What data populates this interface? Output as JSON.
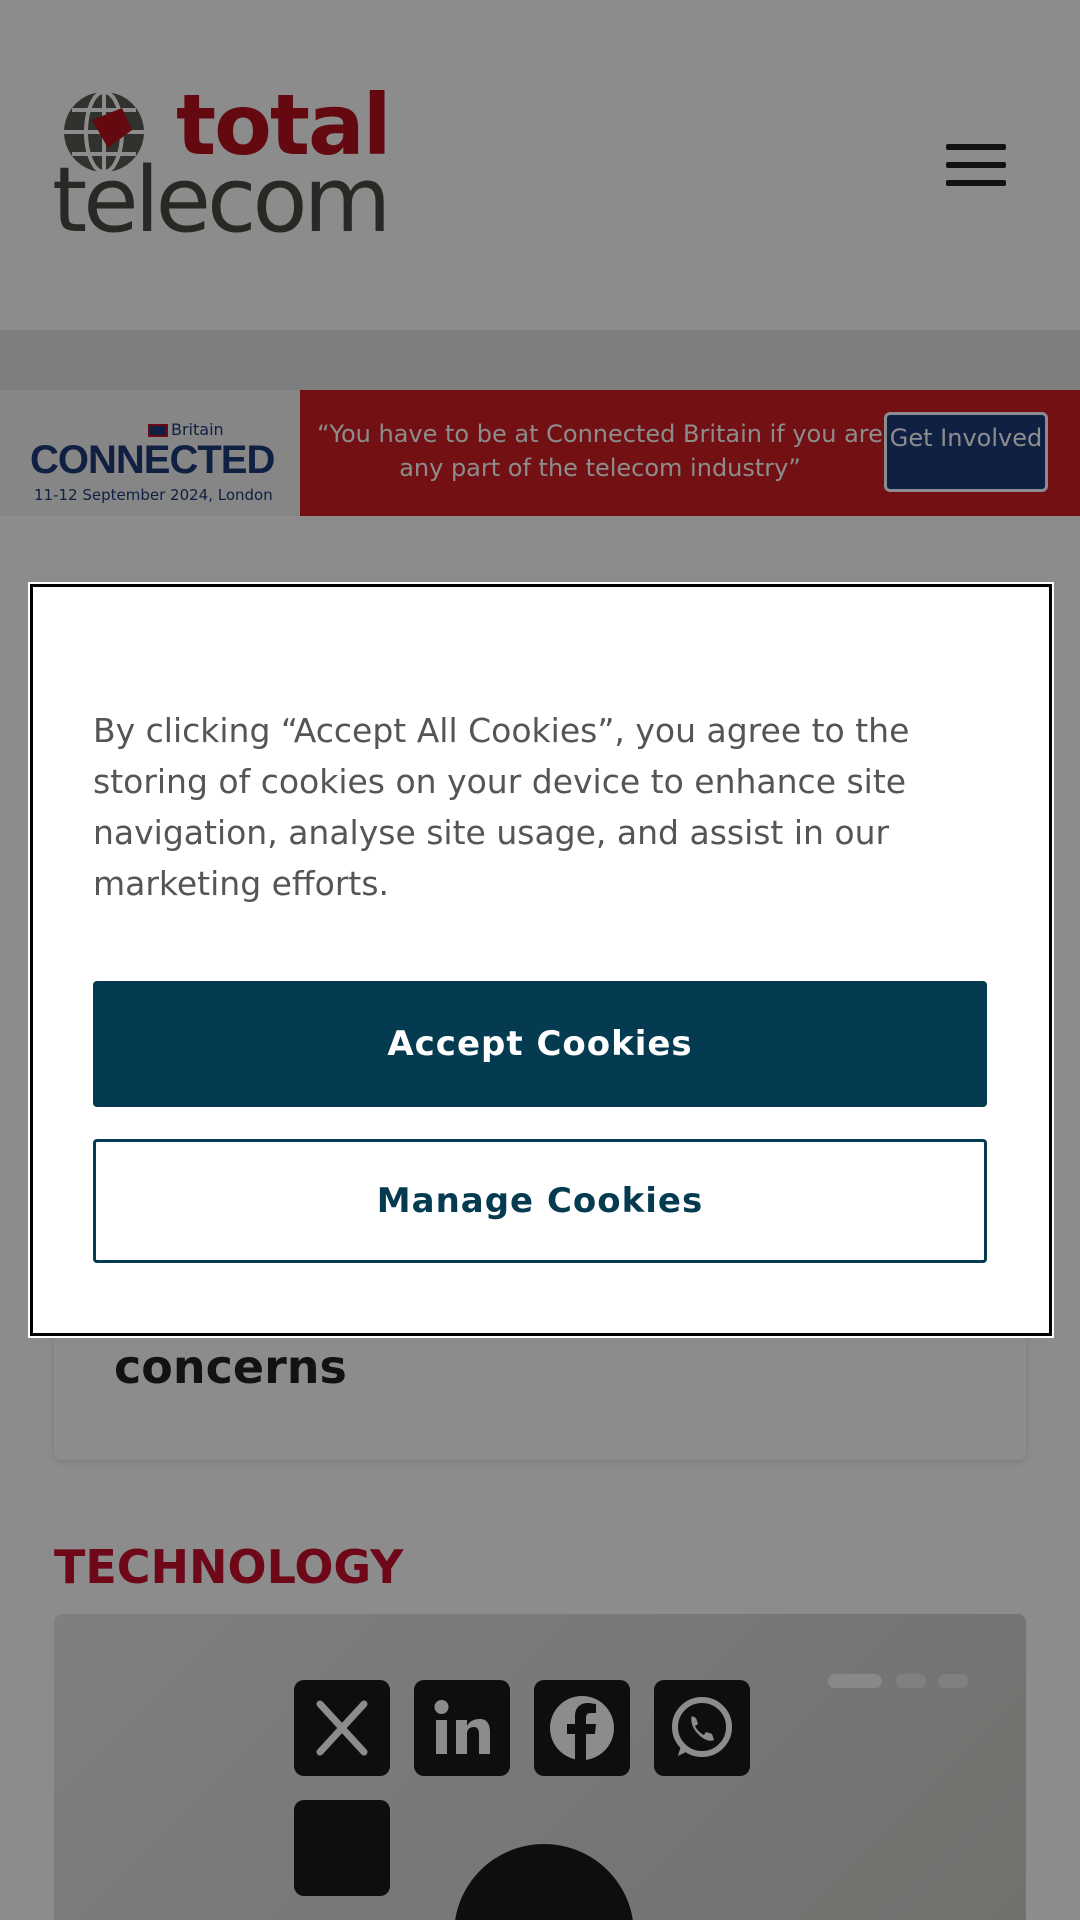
{
  "header": {
    "logo_top": "total",
    "logo_bottom": "telecom"
  },
  "banner": {
    "brand_small": "Britain",
    "brand_large": "CONNECTED",
    "dates": "11-12 September 2024, London",
    "quote": "“You have to be at Connected Britain if you are any part of the telecom industry”",
    "cta": "Get Involved"
  },
  "article": {
    "title_fragment": "concerns"
  },
  "section": {
    "label": "TECHNOLOGY"
  },
  "share_icons": [
    "x-icon",
    "linkedin-icon",
    "facebook-icon",
    "whatsapp-icon",
    "share-icon"
  ],
  "cookie_modal": {
    "text": "By clicking “Accept All Cookies”, you agree to the storing of cookies on your device to enhance site navigation, analyse site usage, and assist in our marketing efforts.",
    "accept_label": "Accept Cookies",
    "manage_label": "Manage Cookies"
  },
  "colors": {
    "brand_red": "#c8102e",
    "cookie_navy": "#053b50",
    "banner_blue": "#1e3b7a"
  }
}
